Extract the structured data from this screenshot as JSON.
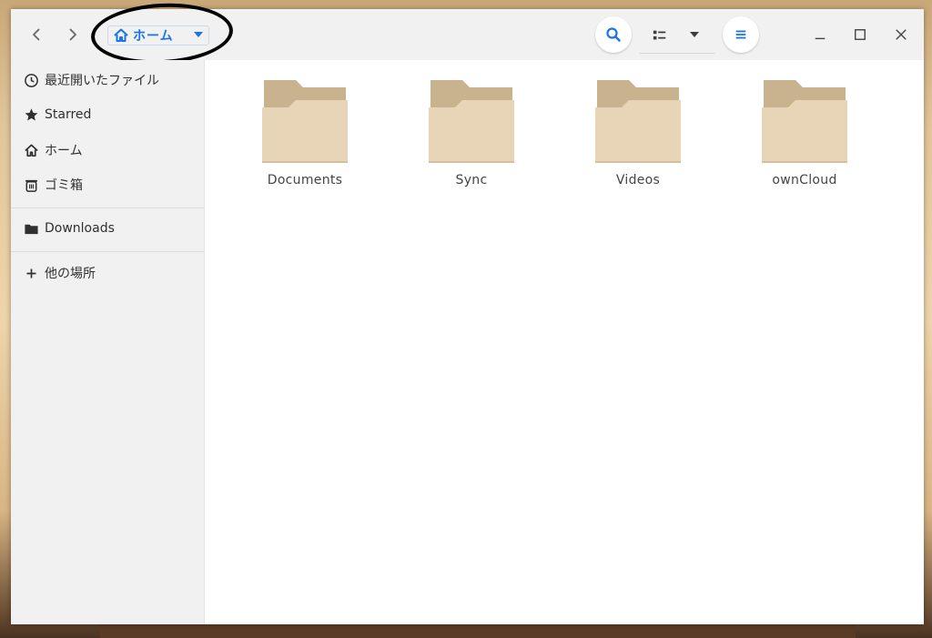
{
  "colors": {
    "accent": "#1a73e8",
    "folder_back": "#c9b38f",
    "folder_front": "#e8d5b8",
    "sidebar_bg": "#f1f1f1",
    "header_bg": "#f1f1f1"
  },
  "header": {
    "back_icon": "chevron-left-icon",
    "forward_icon": "chevron-right-icon",
    "location": {
      "icon": "home-icon",
      "label": "ホーム",
      "dropdown_icon": "caret-down-icon"
    },
    "search_icon": "search-icon",
    "view_icon": "list-view-icon",
    "view_dropdown_icon": "caret-down-icon",
    "menu_icon": "hamburger-menu-icon",
    "window_controls": [
      "minimize-icon",
      "maximize-icon",
      "close-icon"
    ]
  },
  "sidebar": {
    "items": [
      {
        "icon": "clock-icon",
        "label": "最近開いたファイル"
      },
      {
        "icon": "star-icon",
        "label": "Starred"
      },
      {
        "icon": "home-icon",
        "label": "ホーム"
      },
      {
        "icon": "trash-icon",
        "label": "ゴミ箱"
      },
      {
        "icon": "folder-icon",
        "label": "Downloads"
      },
      {
        "icon": "plus-icon",
        "label": "他の場所"
      }
    ]
  },
  "main": {
    "files": [
      {
        "icon": "folder-icon",
        "name": "Documents"
      },
      {
        "icon": "folder-icon",
        "name": "Sync"
      },
      {
        "icon": "folder-icon",
        "name": "Videos"
      },
      {
        "icon": "folder-icon",
        "name": "ownCloud"
      }
    ]
  }
}
